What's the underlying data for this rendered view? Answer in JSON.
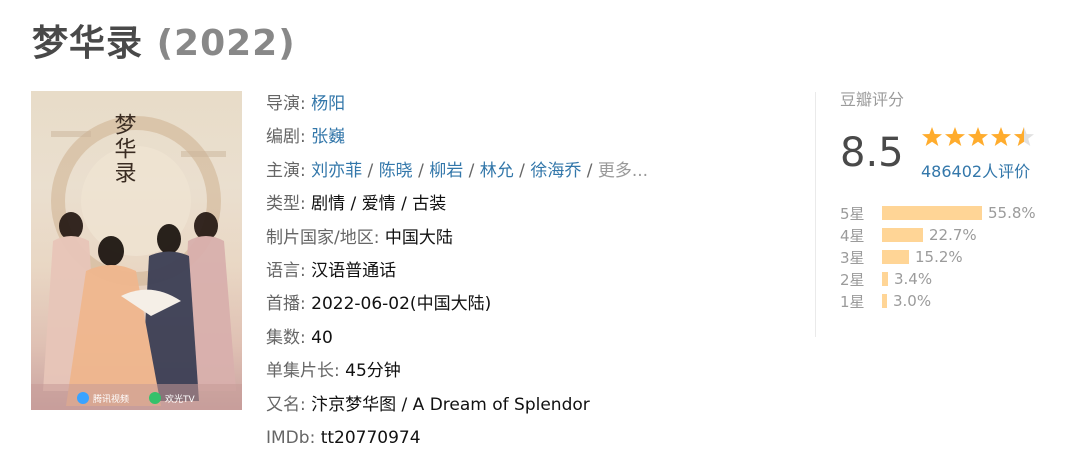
{
  "title": {
    "name": "梦华录",
    "year": "(2022)"
  },
  "poster": {
    "alt": "梦华录 poster",
    "poster_title": "梦华录",
    "studio_logos": [
      "腾讯视频",
      "欢光TV"
    ]
  },
  "info": {
    "director_label": "导演:",
    "director": "杨阳",
    "writer_label": "编剧:",
    "writer": "张巍",
    "cast_label": "主演:",
    "cast": [
      "刘亦菲",
      "陈晓",
      "柳岩",
      "林允",
      "徐海乔"
    ],
    "cast_more": "更多...",
    "genre_label": "类型:",
    "genre": "剧情 / 爱情 / 古装",
    "region_label": "制片国家/地区:",
    "region": "中国大陆",
    "language_label": "语言:",
    "language": "汉语普通话",
    "premiere_label": "首播:",
    "premiere": "2022-06-02(中国大陆)",
    "episodes_label": "集数:",
    "episodes": "40",
    "runtime_label": "单集片长:",
    "runtime": "45分钟",
    "aka_label": "又名:",
    "aka": "汴京梦华图 / A Dream of Splendor",
    "imdb_label": "IMDb:",
    "imdb": "tt20770974"
  },
  "rating": {
    "header": "豆瓣评分",
    "score": "8.5",
    "stars_value": 4.5,
    "votes": "486402人评价",
    "breakdown": [
      {
        "label": "5星",
        "percent": "55.8%",
        "fraction": 0.558
      },
      {
        "label": "4星",
        "percent": "22.7%",
        "fraction": 0.227
      },
      {
        "label": "3星",
        "percent": "15.2%",
        "fraction": 0.152
      },
      {
        "label": "2星",
        "percent": "3.4%",
        "fraction": 0.034
      },
      {
        "label": "1星",
        "percent": "3.0%",
        "fraction": 0.03
      }
    ]
  },
  "colors": {
    "link": "#3377aa",
    "star": "#ffac2d",
    "bar": "#ffd596",
    "label": "#666666"
  }
}
